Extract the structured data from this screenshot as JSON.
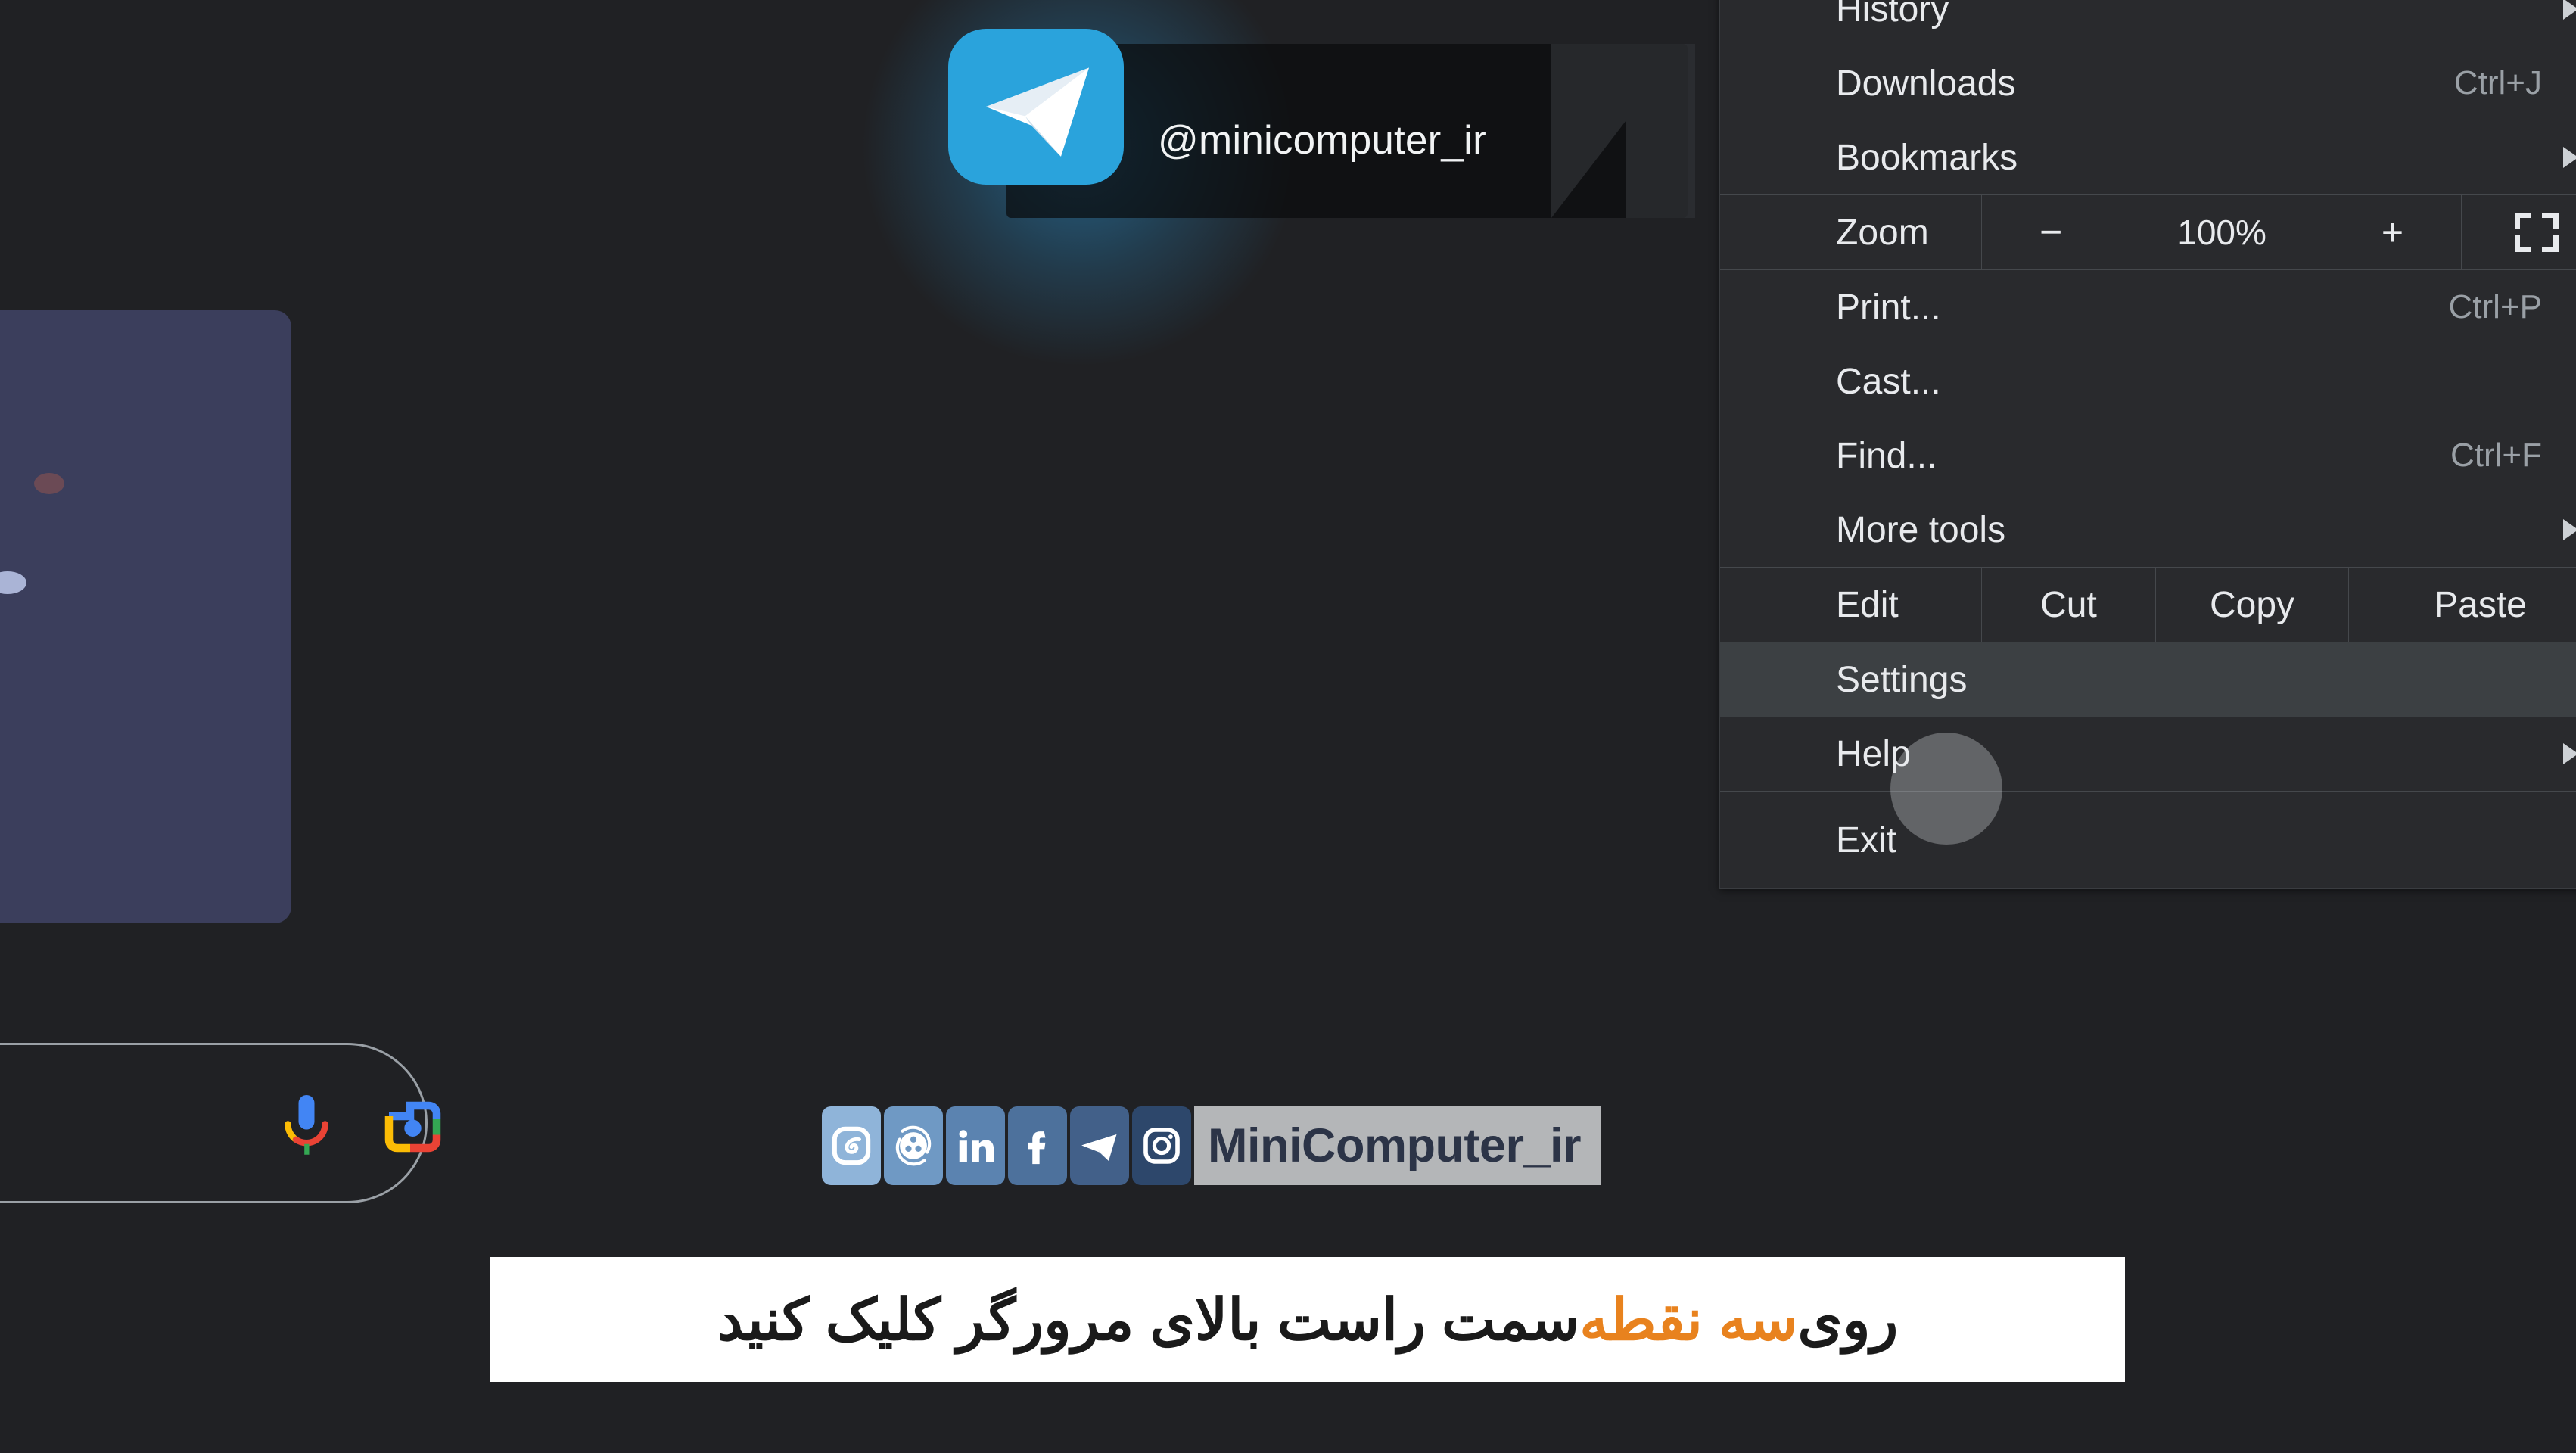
{
  "theme": {
    "page_bg": "#202124",
    "menu_bg": "#292a2d",
    "menu_highlight": "#3c4043",
    "text": "#e8eaed",
    "muted": "#9aa0a6",
    "telegram_blue": "#2aa3dc",
    "accent_orange": "#e8821e",
    "badge_gray": "#b4b6b8",
    "card_navy": "#3b3e5c"
  },
  "telegram_badge": {
    "handle": "@minicomputer_ir",
    "icon": "telegram-paper-plane-icon"
  },
  "search_bar": {
    "mic_icon": "google-microphone-icon",
    "lens_icon": "google-lens-camera-icon"
  },
  "menu": {
    "items": [
      {
        "label": "History",
        "accel": "",
        "submenu": true
      },
      {
        "label": "Downloads",
        "accel": "Ctrl+J",
        "submenu": false
      },
      {
        "label": "Bookmarks",
        "accel": "",
        "submenu": true
      }
    ],
    "zoom": {
      "label": "Zoom",
      "minus": "−",
      "value": "100%",
      "plus": "+",
      "fullscreen_icon": "fullscreen-icon"
    },
    "items2": [
      {
        "label": "Print...",
        "accel": "Ctrl+P",
        "submenu": false
      },
      {
        "label": "Cast...",
        "accel": "",
        "submenu": false
      },
      {
        "label": "Find...",
        "accel": "Ctrl+F",
        "submenu": false
      },
      {
        "label": "More tools",
        "accel": "",
        "submenu": true
      }
    ],
    "edit_row": {
      "label": "Edit",
      "actions": [
        "Cut",
        "Copy",
        "Paste"
      ]
    },
    "settings": {
      "label": "Settings",
      "highlighted": true
    },
    "help": {
      "label": "Help",
      "submenu": true
    },
    "exit": {
      "label": "Exit"
    }
  },
  "social_bar": {
    "icons": [
      {
        "name": "eitaa-icon",
        "glyph": "e",
        "bg": "#8fb4d9"
      },
      {
        "name": "bale-icon",
        "glyph": "*",
        "bg": "#6f99c4"
      },
      {
        "name": "linkedin-icon",
        "glyph": "in",
        "bg": "#5b83b0"
      },
      {
        "name": "facebook-icon",
        "glyph": "f",
        "bg": "#4d719c"
      },
      {
        "name": "telegram-icon",
        "glyph": "➤",
        "bg": "#426089"
      },
      {
        "name": "instagram-icon",
        "glyph": "▣",
        "bg": "#2d476b"
      }
    ],
    "brand": "MiniComputer_ir"
  },
  "caption": {
    "before": "روی ",
    "highlight": "سه نقطه",
    "after": " سمت راست بالای مرورگر کلیک کنید",
    "full": "روی سه نقطه سمت راست بالای مرورگر کلیک کنید"
  }
}
